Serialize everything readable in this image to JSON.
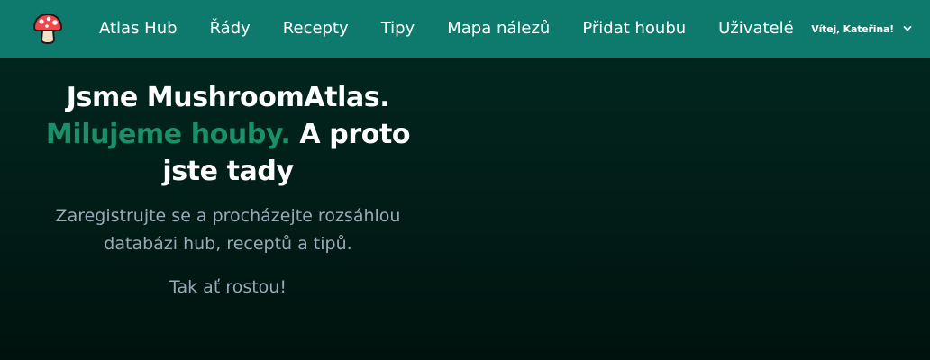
{
  "nav": {
    "logo_icon": "mushroom-icon",
    "links": [
      {
        "label": "Atlas Hub"
      },
      {
        "label": "Řády"
      },
      {
        "label": "Recepty"
      },
      {
        "label": "Tipy"
      },
      {
        "label": "Mapa nálezů"
      },
      {
        "label": "Přidat houbu"
      },
      {
        "label": "Uživatelé"
      }
    ],
    "user_greeting": "Vítej, Kateřina!",
    "user_menu_icon": "chevron-down-icon"
  },
  "hero": {
    "title_line1": "Jsme MushroomAtlas.",
    "title_accent": "Milujeme houby.",
    "title_rest": " A proto jste tady",
    "text": "Zaregistrujte se a procházejte rozsáhlou databázi hub, receptů a tipů.",
    "text2": "Tak ať rostou!"
  },
  "colors": {
    "navbar": "#0e7a6d",
    "background": "#012a21",
    "accent": "#1a9068",
    "muted_text": "#9aa9b8"
  }
}
